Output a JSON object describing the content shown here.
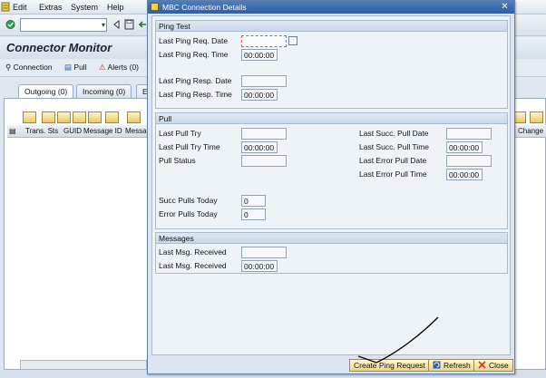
{
  "menu": {
    "items": [
      "Edit",
      "Extras",
      "System",
      "Help"
    ]
  },
  "screen": {
    "title": "Connector Monitor",
    "app_toolbar": {
      "connection": "Connection",
      "pull": "Pull",
      "alerts": "Alerts (0)"
    },
    "tabs": [
      "Outgoing (0)",
      "Incoming (0)",
      "E"
    ],
    "columns": [
      "Trans. Sts",
      "GUID",
      "Message ID",
      "Messa",
      "Change"
    ]
  },
  "dialog": {
    "title": "MBC Connection Details",
    "ping_test": {
      "header": "Ping Test",
      "req_date_label": "Last Ping Req. Date",
      "req_date_value": "",
      "req_time_label": "Last Ping Req. Time",
      "req_time_value": "00:00:00",
      "resp_date_label": "Last Ping Resp. Date",
      "resp_date_value": "",
      "resp_time_label": "Last Ping Resp. Time",
      "resp_time_value": "00:00:00"
    },
    "pull": {
      "header": "Pull",
      "last_try_label": "Last Pull Try",
      "last_try_value": "",
      "last_try_time_label": "Last Pull Try Time",
      "last_try_time_value": "00:00:00",
      "status_label": "Pull Status",
      "status_value": "",
      "succ_today_label": "Succ Pulls Today",
      "succ_today_value": "0",
      "err_today_label": "Error Pulls Today",
      "err_today_value": "0",
      "succ_date_label": "Last Succ. Pull Date",
      "succ_date_value": "",
      "succ_time_label": "Last Succ. Pull Time",
      "succ_time_value": "00:00:00",
      "err_date_label": "Last Error Pull Date",
      "err_date_value": "",
      "err_time_label": "Last Error Pull Time",
      "err_time_value": "00:00:00"
    },
    "messages": {
      "header": "Messages",
      "received_label": "Last Msg. Received",
      "received_value": "",
      "received_time_label": "Last Msg. Received",
      "received_time_value": "00:00:00"
    },
    "buttons": {
      "ping": "Create Ping Request",
      "refresh": "Refresh",
      "close": "Close"
    }
  },
  "colors": {
    "dialog_title": "#2f5ea3",
    "button": "#ebd58a",
    "focus": "#d9534f"
  }
}
